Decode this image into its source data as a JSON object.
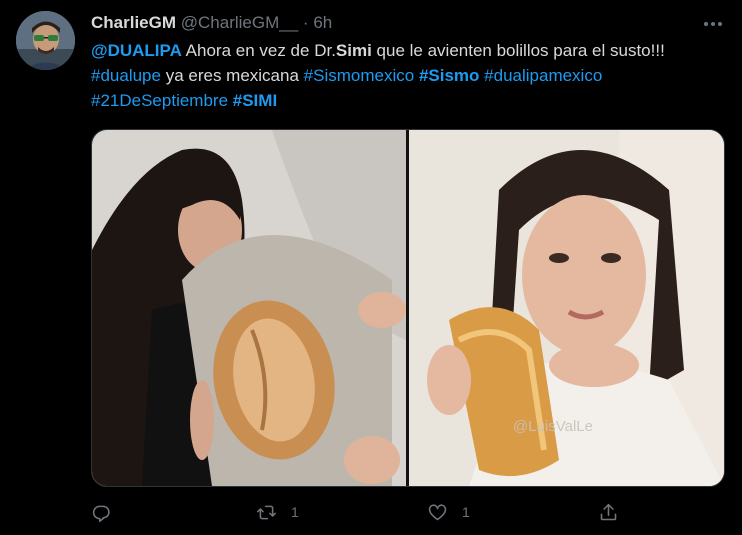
{
  "tweet": {
    "author_name": "CharlieGM",
    "author_handle": "@CharlieGM__",
    "separator": "·",
    "time": "6h",
    "text_lines": [
      [
        {
          "t": "@DUALIPA",
          "link": true,
          "bold": true
        },
        {
          "t": " Ahora en vez de Dr.",
          "link": false,
          "bold": false
        },
        {
          "t": "Simi",
          "link": false,
          "bold": true
        },
        {
          "t": " que le avienten bolillos para el susto!!!",
          "link": false,
          "bold": false
        }
      ],
      [
        {
          "t": "#dualupe",
          "link": true,
          "bold": false
        },
        {
          "t": " ya eres mexicana ",
          "link": false,
          "bold": false
        },
        {
          "t": "#Sismomexico",
          "link": true,
          "bold": false
        },
        {
          "t": " ",
          "link": false,
          "bold": false
        },
        {
          "t": "#Sismo",
          "link": true,
          "bold": true
        },
        {
          "t": " ",
          "link": false,
          "bold": false
        },
        {
          "t": "#dualipamexico",
          "link": true,
          "bold": false
        }
      ],
      [
        {
          "t": "#21DeSeptiembre",
          "link": true,
          "bold": false
        },
        {
          "t": " ",
          "link": false,
          "bold": false
        },
        {
          "t": "#SIMI",
          "link": true,
          "bold": true
        }
      ]
    ],
    "watermark": "@LuisValLe",
    "actions": {
      "reply_icon": "reply-icon",
      "retweet_icon": "retweet-icon",
      "retweet_count": "1",
      "like_icon": "like-icon",
      "like_count": "1",
      "share_icon": "share-icon"
    }
  },
  "colors": {
    "background": "#000000",
    "text": "#d9d9d9",
    "muted": "#6e767d",
    "link": "#1d9bf0"
  }
}
